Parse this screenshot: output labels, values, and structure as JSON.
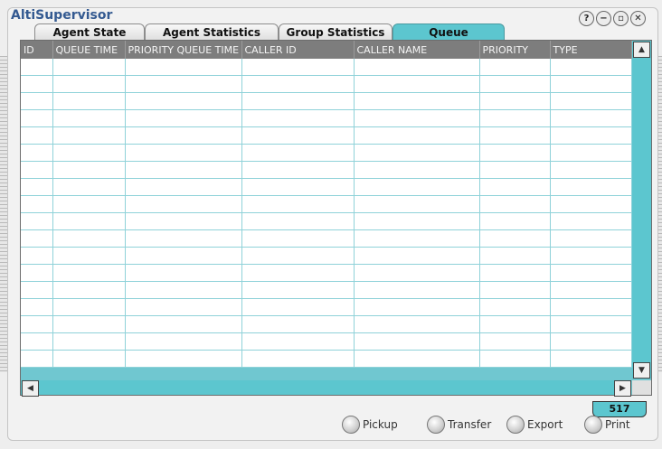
{
  "app": {
    "title": "AltiSupervisor",
    "window_buttons": [
      "?",
      "−",
      "▫",
      "✕"
    ]
  },
  "tabs": [
    {
      "label": "Agent State",
      "active": false
    },
    {
      "label": "Agent Statistics",
      "active": false
    },
    {
      "label": "Group Statistics",
      "active": false
    },
    {
      "label": "Queue",
      "active": true
    }
  ],
  "table": {
    "columns": [
      "ID",
      "QUEUE TIME",
      "PRIORITY QUEUE TIME",
      "CALLER ID",
      "CALLER NAME",
      "PRIORITY",
      "TYPE"
    ],
    "empty_rows": 18
  },
  "scroll": {
    "up": "▲",
    "down": "▼",
    "left": "◀",
    "right": "▶"
  },
  "status": {
    "count": "517"
  },
  "actions": [
    {
      "label": "Pickup"
    },
    {
      "label": "Transfer"
    },
    {
      "label": "Export"
    },
    {
      "label": "Print"
    }
  ],
  "colors": {
    "accent": "#5cc6cf",
    "header": "#7d7d7d",
    "title": "#345a91"
  }
}
